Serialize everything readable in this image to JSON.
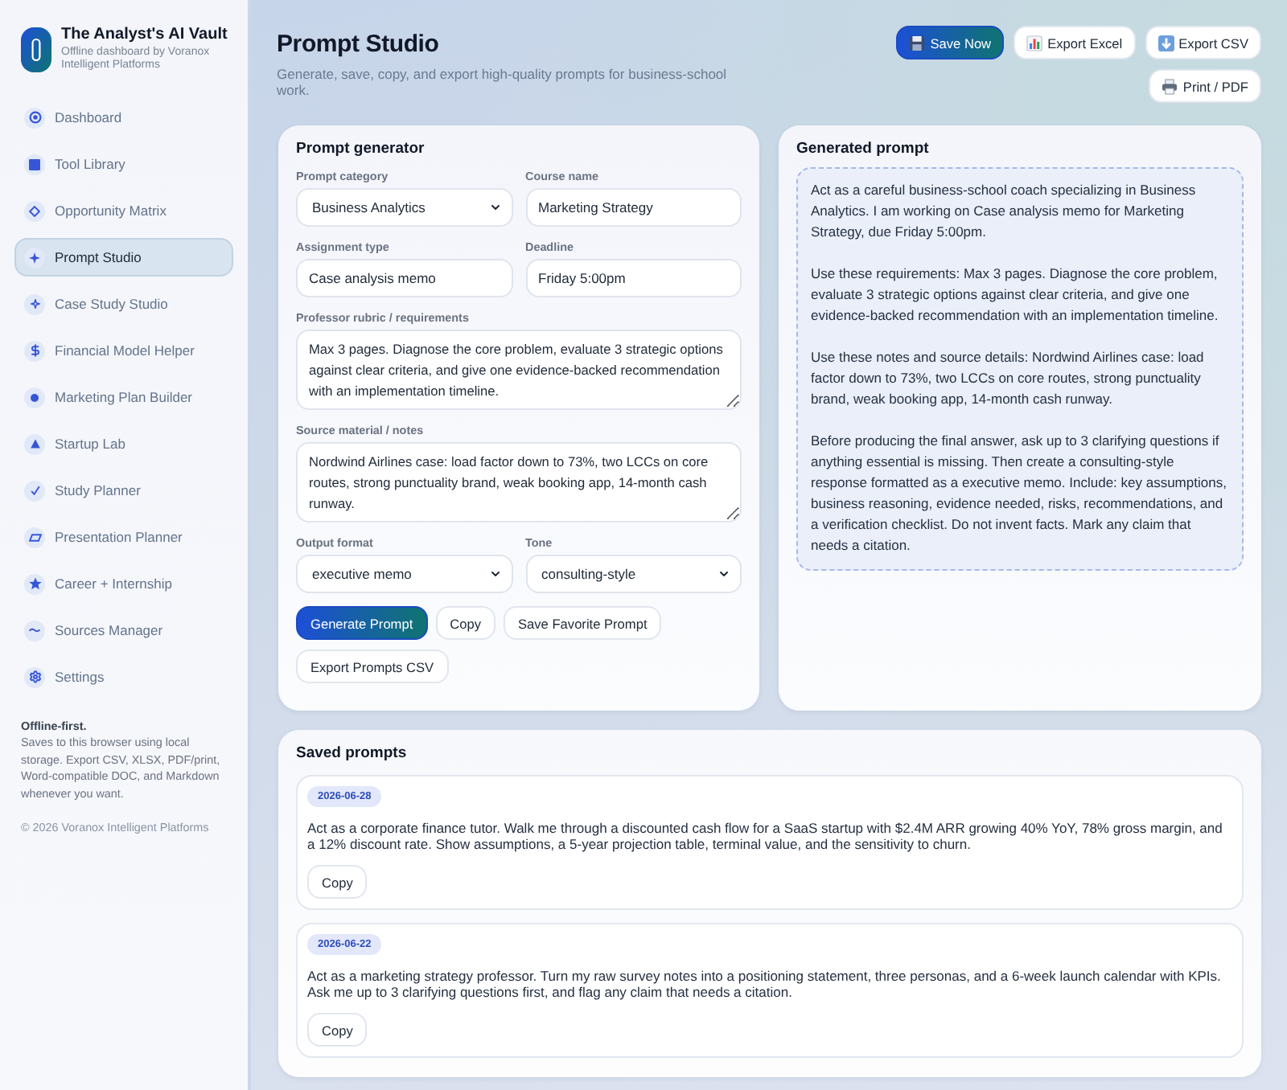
{
  "sidebar": {
    "brand": {
      "title": "The Analyst's AI Vault",
      "subtitle": "Offline dashboard by Voranox Intelligent Platforms"
    },
    "items": [
      {
        "label": "Dashboard",
        "selected": false
      },
      {
        "label": "Tool Library",
        "selected": false
      },
      {
        "label": "Opportunity Matrix",
        "selected": false
      },
      {
        "label": "Prompt Studio",
        "selected": true
      },
      {
        "label": "Case Study Studio",
        "selected": false
      },
      {
        "label": "Financial Model Helper",
        "selected": false
      },
      {
        "label": "Marketing Plan Builder",
        "selected": false
      },
      {
        "label": "Startup Lab",
        "selected": false
      },
      {
        "label": "Study Planner",
        "selected": false
      },
      {
        "label": "Presentation Planner",
        "selected": false
      },
      {
        "label": "Career + Internship",
        "selected": false
      },
      {
        "label": "Sources Manager",
        "selected": false
      },
      {
        "label": "Settings",
        "selected": false
      }
    ],
    "note": {
      "title": "Offline-first.",
      "text": "Saves to this browser using local storage. Export CSV, XLSX, PDF/print, Word-compatible DOC, and Markdown whenever you want."
    },
    "copyright": "© 2026 Voranox Intelligent Platforms"
  },
  "header": {
    "title": "Prompt Studio",
    "subtitle": "Generate, save, copy, and export high-quality prompts for business-school work.",
    "actions": [
      {
        "label": "Save Now",
        "kind": "primary"
      },
      {
        "label": "Export Excel",
        "kind": "secondary"
      },
      {
        "label": "Export CSV",
        "kind": "secondary"
      },
      {
        "label": "Print / PDF",
        "kind": "secondary"
      }
    ]
  },
  "generator": {
    "title": "Prompt generator",
    "fields": [
      {
        "kind": "select",
        "label": "Prompt category",
        "value": "Business Analytics"
      },
      {
        "kind": "input",
        "label": "Course name",
        "value": "Marketing Strategy"
      },
      {
        "kind": "input",
        "label": "Assignment type",
        "value": "Case analysis memo"
      },
      {
        "kind": "input",
        "label": "Deadline",
        "value": "Friday 5:00pm"
      },
      {
        "kind": "textarea",
        "label": "Professor rubric / requirements",
        "value": "Max 3 pages. Diagnose the core problem, evaluate 3 strategic options against clear criteria, and give one evidence-backed recommendation with an implementation timeline."
      },
      {
        "kind": "textarea",
        "label": "Source material / notes",
        "value": "Nordwind Airlines case: load factor down to 73%, two LCCs on core routes, strong punctuality brand, weak booking app, 14-month cash runway."
      },
      {
        "kind": "select",
        "label": "Output format",
        "value": "executive memo"
      },
      {
        "kind": "select",
        "label": "Tone",
        "value": "consulting-style"
      }
    ],
    "buttons": [
      {
        "label": "Generate Prompt",
        "kind": "primary"
      },
      {
        "label": "Copy",
        "kind": "secondary"
      },
      {
        "label": "Save Favorite Prompt",
        "kind": "secondary"
      },
      {
        "label": "Export Prompts CSV",
        "kind": "secondary"
      }
    ]
  },
  "output": {
    "title": "Generated prompt",
    "paragraphs": [
      "Act as a careful business-school coach specializing in Business Analytics. I am working on Case analysis memo for Marketing Strategy, due Friday 5:00pm.",
      "Use these requirements: Max 3 pages. Diagnose the core problem, evaluate 3 strategic options against clear criteria, and give one evidence-backed recommendation with an implementation timeline.",
      "Use these notes and source details: Nordwind Airlines case: load factor down to 73%, two LCCs on core routes, strong punctuality brand, weak booking app, 14-month cash runway.",
      "Before producing the final answer, ask up to 3 clarifying questions if anything essential is missing. Then create a consulting-style response formatted as a executive memo. Include: key assumptions, business reasoning, evidence needed, risks, recommendations, and a verification checklist. Do not invent facts. Mark any claim that needs a citation."
    ]
  },
  "saved": {
    "title": "Saved prompts",
    "items": [
      {
        "date": "2026-06-28",
        "text": "Act as a corporate finance tutor. Walk me through a discounted cash flow for a SaaS startup with $2.4M ARR growing 40% YoY, 78% gross margin, and a 12% discount rate. Show assumptions, a 5-year projection table, terminal value, and the sensitivity to churn.",
        "button": "Copy"
      },
      {
        "date": "2026-06-22",
        "text": "Act as a marketing strategy professor. Turn my raw survey notes into a positioning statement, three personas, and a 6-week launch calendar with KPIs. Ask me up to 3 clarifying questions first, and flag any claim that needs a citation.",
        "button": "Copy"
      }
    ]
  }
}
